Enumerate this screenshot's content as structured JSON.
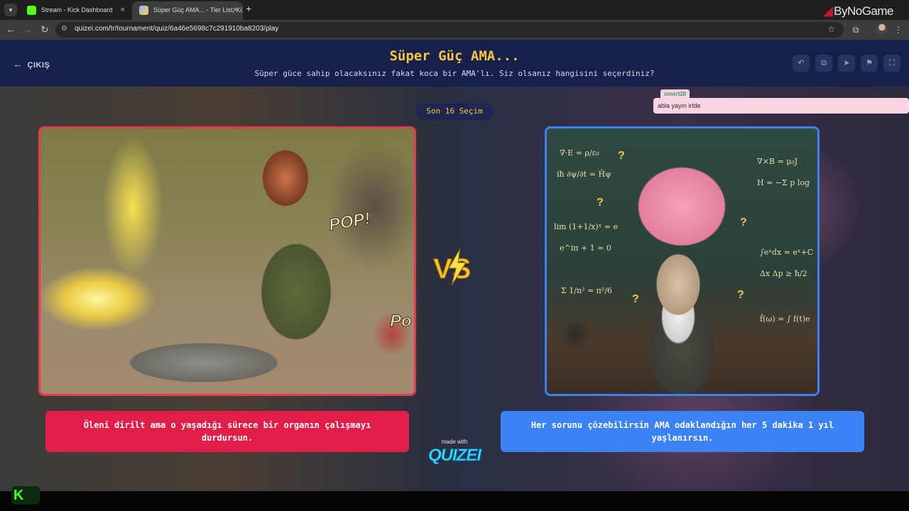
{
  "browser": {
    "tabs": [
      {
        "label": "Stream - Kick Dashboard"
      },
      {
        "label": "Süper Güç AMA... - Tier List, Kü"
      }
    ],
    "url": "quizei.com/tr/tournament/quiz/6a46e5698c7c291910ba8203/play",
    "watermark": "ByNoGame"
  },
  "header": {
    "exit_label": "ÇIKIŞ",
    "title": "Süper Güç AMA...",
    "subtitle": "Süper güce sahip olacaksınız fakat koca bir AMA'lı. Siz olsanız hangisini seçerdiniz?",
    "icons": [
      "undo-icon",
      "copy-icon",
      "send-icon",
      "flag-icon",
      "fullscreen-icon"
    ]
  },
  "round": {
    "label": "Son 16 Seçim"
  },
  "left_option": {
    "caption": "Öleni dirilt ama o yaşadığı sürece bir organın çalışmayı durdursun.",
    "art_texts": [
      "POP!",
      "Po"
    ],
    "border_color": "#e33a4e",
    "caption_color": "#e11d48"
  },
  "right_option": {
    "caption": "Her sorunu çözebilirsin AMA odaklandığın her 5 dakika 1 yıl yaşlanırsın.",
    "border_color": "#3b82f6",
    "caption_color": "#3b82f6"
  },
  "chat": {
    "user": "omert28",
    "message": "abla yayın irlde"
  },
  "vs_label": "VS",
  "branding": {
    "made_with": "made with",
    "name": "QUIZEI"
  }
}
